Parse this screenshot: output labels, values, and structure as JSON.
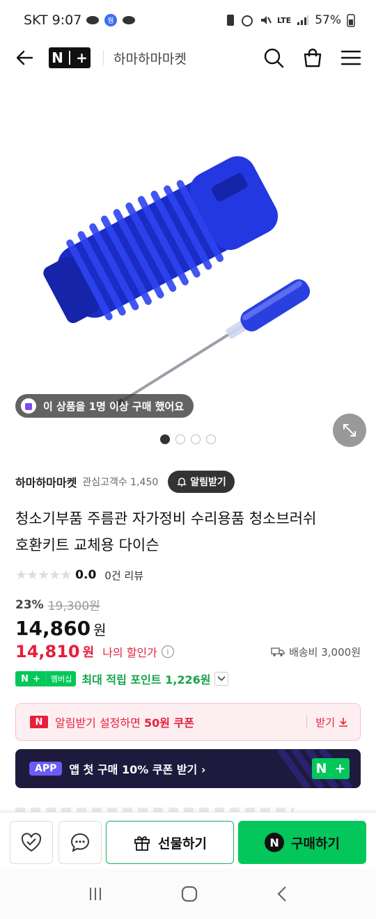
{
  "status": {
    "carrier": "SKT",
    "time": "9:07",
    "network": "LTE",
    "battery": "57%"
  },
  "header": {
    "brand_logo_n": "N",
    "brand_logo_plus": "+",
    "store_name": "하마하마마켓"
  },
  "hero": {
    "buyer_notice": "이 상품을 1명 이상 구매 했어요",
    "slides": 4,
    "active_slide": 1
  },
  "store": {
    "name": "하마하마마켓",
    "fans_label": "관심고객수 1,450",
    "alarm_label": "알림받기"
  },
  "product": {
    "title_line1": "청소기부품 주름관 자가정비 수리용품 청소브러쉬",
    "title_line2": "호환키트 교체용 다이슨",
    "stars": "★★★★★",
    "rating": "0.0",
    "reviews": "0건 리뷰",
    "discount_rate": "23%",
    "original_price": "19,300원",
    "price": "14,860",
    "price_unit": "원",
    "my_price": "14,810",
    "my_price_unit": "원",
    "my_price_label": "나의 할인가",
    "info_mark": "i",
    "shipping": "배송비 3,000원"
  },
  "membership": {
    "badge_n": "N",
    "badge_plus": "+",
    "badge_label": "멤버십",
    "points": "최대 적립 포인트 1,226원"
  },
  "coupon": {
    "badge": "N",
    "message_pre": "알림받기 설정하면 ",
    "message_bold": "50원 쿠폰",
    "get_label": "받기"
  },
  "app_banner": {
    "tag": "APP",
    "text": "앱 첫 구매 10% 쿠폰 받기 ›",
    "logo_n": "N",
    "logo_plus": "+"
  },
  "bottom_bar": {
    "gift_label": "선물하기",
    "buy_badge": "N",
    "buy_label": "구매하기"
  },
  "colors": {
    "naver_green": "#03c75a",
    "discount_red": "#e81e3a",
    "banner_navy": "#1d1a3d",
    "product_blue": "#1f2fd0"
  }
}
